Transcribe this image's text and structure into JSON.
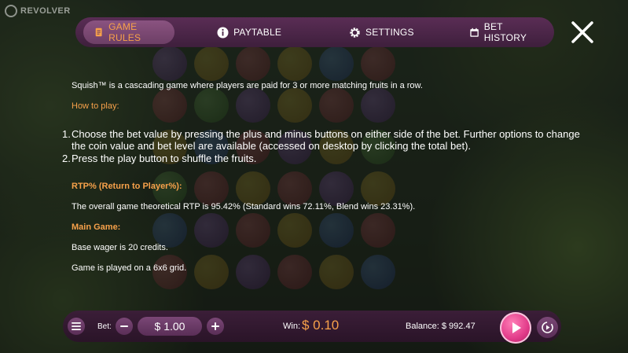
{
  "brand": {
    "name": "REVOLVER"
  },
  "tabs": [
    {
      "label": "GAME RULES",
      "active": true,
      "icon": "document-icon"
    },
    {
      "label": "PAYTABLE",
      "active": false,
      "icon": "info-icon"
    },
    {
      "label": "SETTINGS",
      "active": false,
      "icon": "gear-icon"
    },
    {
      "label": "BET HISTORY",
      "active": false,
      "icon": "calendar-icon"
    }
  ],
  "rules": {
    "intro": "Squish™ is a cascading game where players are paid for 3 or more matching fruits in a row.",
    "how_to_play_heading": "How to play:",
    "steps": [
      {
        "num": "1.",
        "text": "Choose the bet value by pressing the plus and minus buttons on either side of the bet. Further options to change the coin value and bet level are available (accessed on desktop by clicking the total bet)."
      },
      {
        "num": "2.",
        "text": "Press the play button to shuffle the fruits."
      }
    ],
    "rtp_heading": "RTP% (Return to Player%):",
    "rtp_text": "The overall game theoretical RTP is 95.42% (Standard wins 72.11%, Blend wins 23.31%).",
    "main_game_heading": "Main Game:",
    "base_wager": "Base wager is 20 credits.",
    "grid_text": "Game is played on a 6x6 grid."
  },
  "controls": {
    "bet_label": "Bet:",
    "bet_value": "$ 1.00",
    "win_label": "Win:",
    "win_value": "$ 0.10",
    "balance": "Balance: $ 992.47"
  },
  "colors": {
    "accent": "#f7a14a",
    "tabbar": "#4a2546",
    "spin": "#e23c8a"
  }
}
